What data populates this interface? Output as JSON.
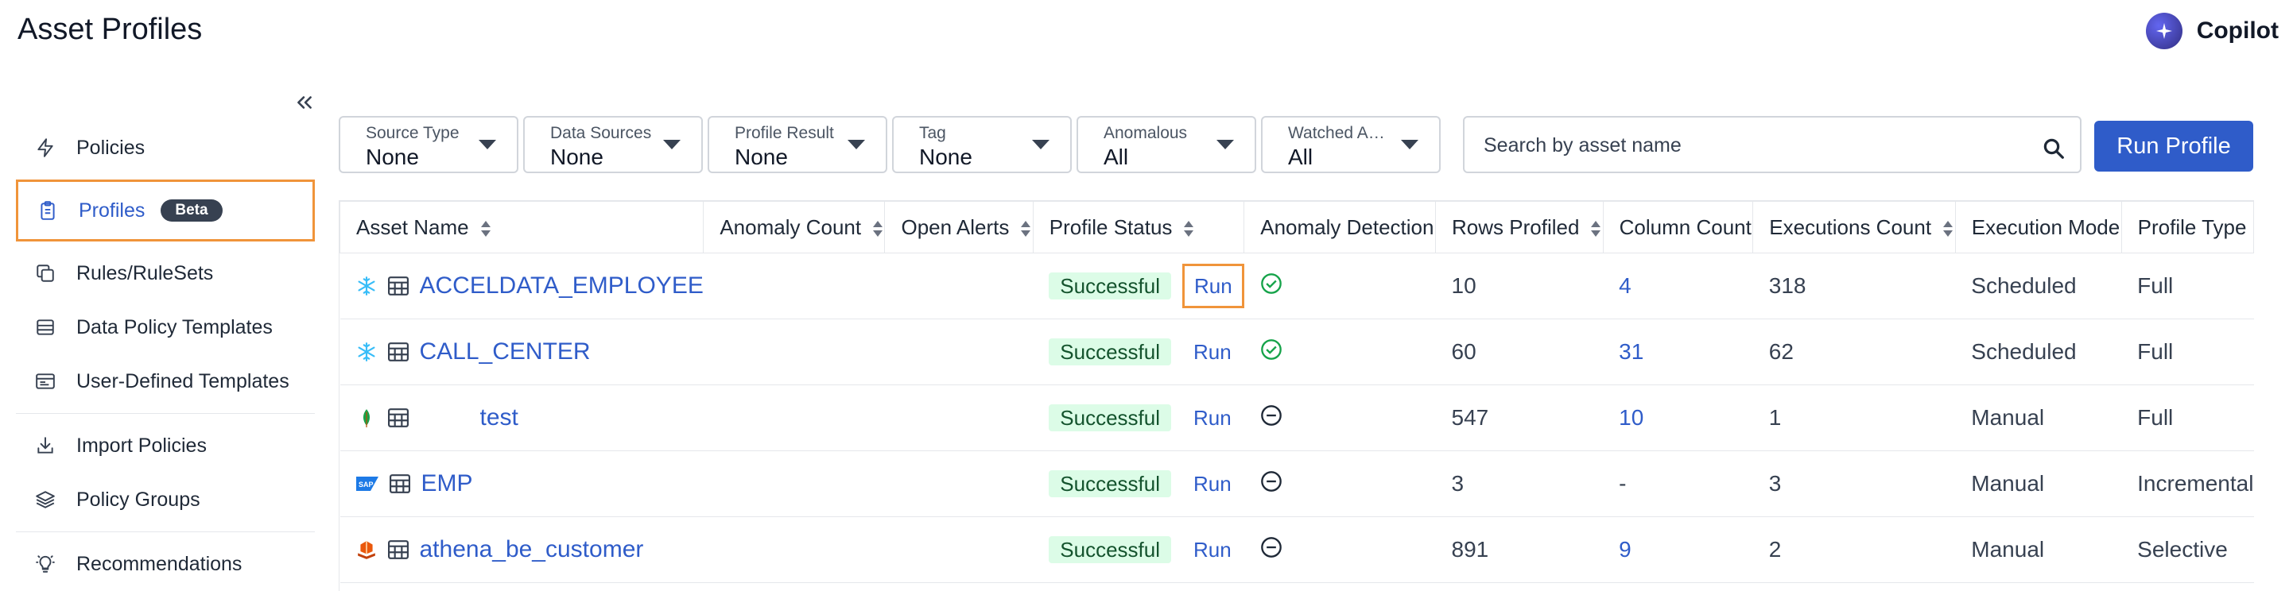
{
  "header": {
    "title": "Asset Profiles",
    "copilot_label": "Copilot"
  },
  "sidebar": {
    "items": [
      {
        "label": "Policies",
        "icon": "lightning-icon"
      },
      {
        "label": "Profiles",
        "icon": "clipboard-icon",
        "badge": "Beta",
        "active": true
      },
      {
        "label": "Rules/RuleSets",
        "icon": "copy-icon"
      },
      {
        "label": "Data Policy Templates",
        "icon": "database-icon"
      },
      {
        "label": "User-Defined Templates",
        "icon": "template-icon"
      },
      {
        "label": "Import Policies",
        "icon": "import-icon"
      },
      {
        "label": "Policy Groups",
        "icon": "layers-icon"
      },
      {
        "label": "Recommendations",
        "icon": "bulb-icon"
      }
    ]
  },
  "filters": [
    {
      "label": "Source Type",
      "value": "None"
    },
    {
      "label": "Data Sources",
      "value": "None"
    },
    {
      "label": "Profile Result",
      "value": "None"
    },
    {
      "label": "Tag",
      "value": "None"
    },
    {
      "label": "Anomalous",
      "value": "All"
    },
    {
      "label": "Watched Assets",
      "value": "All"
    }
  ],
  "search": {
    "placeholder": "Search by asset name"
  },
  "run_profile_label": "Run Profile",
  "table": {
    "columns": [
      "Asset Name",
      "Anomaly Count",
      "Open Alerts",
      "Profile Status",
      "Anomaly Detection",
      "Rows Profiled",
      "Column Count",
      "Executions Count",
      "Execution Mode",
      "Profile Type"
    ],
    "rows": [
      {
        "source_icon": "snowflake-icon",
        "name": "ACCELDATA_EMPLOYEE",
        "status": "Successful",
        "run": "Run",
        "detection": "check-circle-icon",
        "rows": "10",
        "columns": "4",
        "executions": "318",
        "mode": "Scheduled",
        "profile": "Full"
      },
      {
        "source_icon": "snowflake-icon",
        "name": "CALL_CENTER",
        "status": "Successful",
        "run": "Run",
        "detection": "check-circle-icon",
        "rows": "60",
        "columns": "31",
        "executions": "62",
        "mode": "Scheduled",
        "profile": "Full"
      },
      {
        "source_icon": "mongodb-leaf-icon",
        "name": "test",
        "status": "Successful",
        "run": "Run",
        "detection": "minus-circle-icon",
        "rows": "547",
        "columns": "10",
        "executions": "1",
        "mode": "Manual",
        "profile": "Full"
      },
      {
        "source_icon": "sap-icon",
        "name": "EMP",
        "status": "Successful",
        "run": "Run",
        "detection": "minus-circle-icon",
        "rows": "3",
        "columns": "-",
        "executions": "3",
        "mode": "Manual",
        "profile": "Incremental"
      },
      {
        "source_icon": "athena-icon",
        "name": "athena_be_customer",
        "status": "Successful",
        "run": "Run",
        "detection": "minus-circle-icon",
        "rows": "891",
        "columns": "9",
        "executions": "2",
        "mode": "Manual",
        "profile": "Selective"
      }
    ]
  },
  "colors": {
    "accent": "#2f5cc9",
    "highlight": "#f0943a",
    "success_bg": "#dcfce7",
    "success_icon": "#16a34a"
  }
}
